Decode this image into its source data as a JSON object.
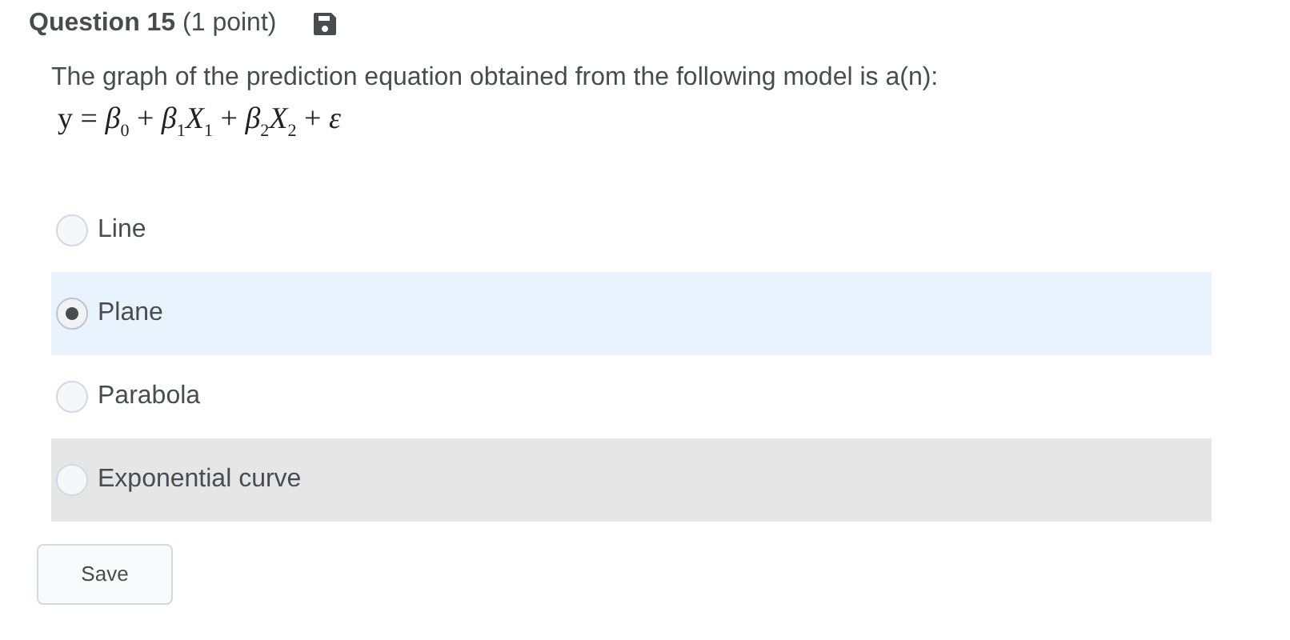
{
  "question": {
    "title": "**Question 15** (1 point)",
    "text": "The graph of the prediction equation obtained from the following model is a(n):",
    "equation": "y = *β*$_{0}$ + *β*$_{1}$*X*$_{1}$ + *β*$_{2}$*X*$_{2}$ + *ε*"
  },
  "options": [
    {
      "label": "Line",
      "selected": false,
      "hovered": false
    },
    {
      "label": "Plane",
      "selected": true,
      "hovered": false
    },
    {
      "label": "Parabola",
      "selected": false,
      "hovered": false
    },
    {
      "label": "Exponential curve",
      "selected": false,
      "hovered": true
    }
  ],
  "buttons": [
    "Save"
  ]
}
